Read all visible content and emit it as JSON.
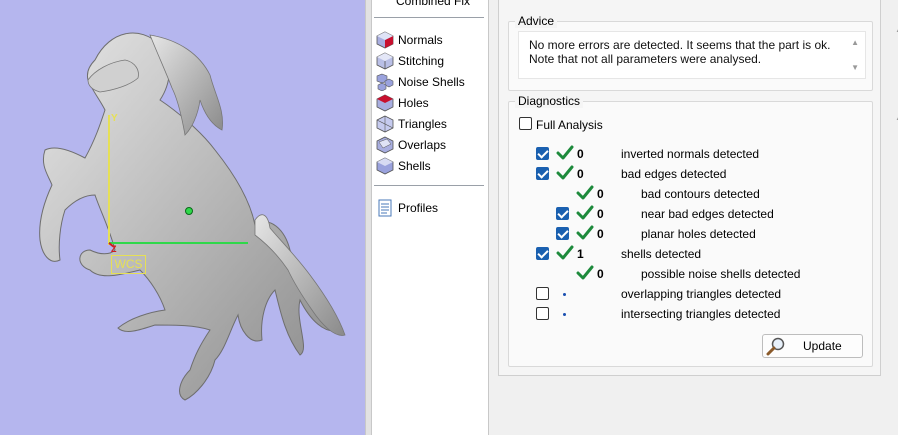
{
  "viewport": {
    "wcs_label": "WCS",
    "axis_y": "Y",
    "axis_z": "Z",
    "background": "#b5b6ee"
  },
  "tree": {
    "top_item": "Combined Fix",
    "items": [
      {
        "label": "Normals",
        "icon": "normals-cube-icon"
      },
      {
        "label": "Stitching",
        "icon": "stitching-cube-icon"
      },
      {
        "label": "Noise Shells",
        "icon": "noise-shells-icon"
      },
      {
        "label": "Holes",
        "icon": "holes-cube-icon"
      },
      {
        "label": "Triangles",
        "icon": "triangles-cube-icon"
      },
      {
        "label": "Overlaps",
        "icon": "overlaps-cube-icon"
      },
      {
        "label": "Shells",
        "icon": "shells-cube-icon"
      }
    ],
    "profiles": {
      "label": "Profiles",
      "icon": "document-icon"
    }
  },
  "advice": {
    "title": "Advice",
    "text": "No more errors are detected. It seems that the part is ok. Note that not all parameters were analysed."
  },
  "diagnostics": {
    "title": "Diagnostics",
    "full_analysis_label": "Full Analysis",
    "rows": [
      {
        "checked": true,
        "status": "ok",
        "count": "0",
        "label": "inverted normals detected",
        "level": 0
      },
      {
        "checked": true,
        "status": "ok",
        "count": "0",
        "label": "bad edges detected",
        "level": 0
      },
      {
        "checked": null,
        "status": "ok",
        "count": "0",
        "label": "bad contours detected",
        "level": 1
      },
      {
        "checked": true,
        "status": "ok",
        "count": "0",
        "label": "near bad edges detected",
        "level": 1
      },
      {
        "checked": true,
        "status": "ok",
        "count": "0",
        "label": "planar holes detected",
        "level": 1
      },
      {
        "checked": true,
        "status": "ok",
        "count": "1",
        "label": "shells detected",
        "level": 0
      },
      {
        "checked": null,
        "status": "ok",
        "count": "0",
        "label": "possible noise shells detected",
        "level": 1
      },
      {
        "checked": false,
        "status": "none",
        "count": "",
        "label": "overlapping triangles detected",
        "level": 0
      },
      {
        "checked": false,
        "status": "none",
        "count": "",
        "label": "intersecting triangles detected",
        "level": 0
      }
    ],
    "update_label": "Update"
  },
  "colors": {
    "check_green": "#1e8a3c",
    "checkbox_blue": "#1a60b0",
    "axis_yellow": "#e6e055",
    "axis_green": "#2fd84a"
  }
}
